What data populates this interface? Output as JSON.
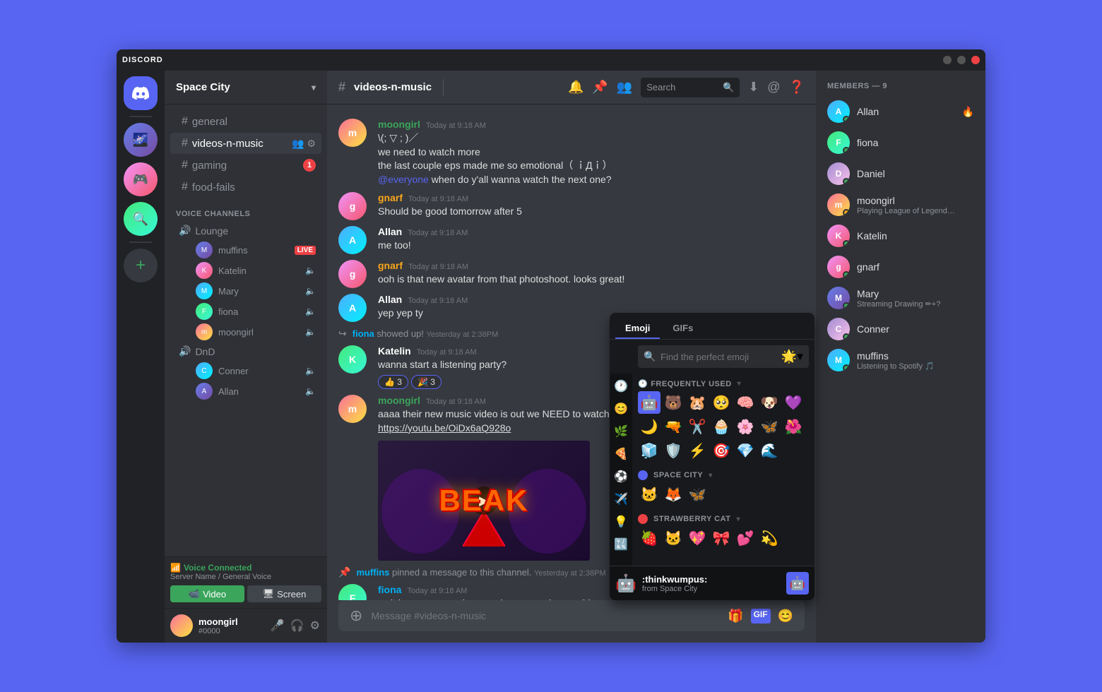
{
  "window": {
    "title": "DISCORD",
    "minimize": "—",
    "maximize": "□",
    "close": "✕"
  },
  "server": {
    "name": "Space City",
    "chevron": "▾"
  },
  "channels": {
    "text": [
      {
        "name": "general",
        "type": "text"
      },
      {
        "name": "videos-n-music",
        "type": "text",
        "active": true,
        "has_settings": true
      },
      {
        "name": "gaming",
        "type": "text",
        "badge": "1"
      },
      {
        "name": "food-fails",
        "type": "text"
      }
    ],
    "voice_header": "VOICE CHANNELS",
    "voice": [
      {
        "name": "Lounge",
        "users": [
          {
            "name": "muffins",
            "live": true,
            "class": "muffins"
          },
          {
            "name": "Katelin",
            "class": "katelin"
          },
          {
            "name": "Mary",
            "class": "mary"
          },
          {
            "name": "fiona",
            "class": "fiona"
          },
          {
            "name": "moongirl",
            "class": "moongirl"
          }
        ]
      },
      {
        "name": "DnD",
        "users": [
          {
            "name": "Conner",
            "class": "mary"
          },
          {
            "name": "Allan",
            "class": "msg-av-1"
          }
        ]
      }
    ]
  },
  "current_channel": "videos-n-music",
  "header": {
    "channel_icon": "#",
    "channel_name": "videos-n-music",
    "search_placeholder": "Search",
    "actions": [
      "bell",
      "pin",
      "members",
      "search",
      "download",
      "mention",
      "help"
    ]
  },
  "messages": [
    {
      "id": "m1",
      "avatar_class": "msg-av-5",
      "username": "moongirl",
      "username_color": "green",
      "time": "Today at 9:18 AM",
      "text": "\\(; ▽ ; )／",
      "text2": "we need to watch more",
      "text3": "the last couple eps made me so emotional（ ｉДｉ）",
      "text4": "@everyone when do y'all wanna watch the next one?"
    },
    {
      "id": "m2",
      "avatar_class": "msg-av-2",
      "username": "gnarf",
      "username_color": "orange",
      "time": "Today at 9:18 AM",
      "text": "Should be good tomorrow after 5"
    },
    {
      "id": "m3",
      "avatar_class": "msg-av-3",
      "username": "Allan",
      "username_color": "white",
      "time": "Today at 9:18 AM",
      "text": "me too!"
    },
    {
      "id": "m4",
      "avatar_class": "msg-av-2",
      "username": "gnarf",
      "username_color": "orange",
      "time": "Today at 9:18 AM",
      "text": "ooh is that new avatar from that photoshoot. looks great!"
    },
    {
      "id": "m5",
      "avatar_class": "msg-av-3",
      "username": "Allan",
      "username_color": "white",
      "time": "Today at 9:18 AM",
      "text": "yep yep ty"
    },
    {
      "id": "m6",
      "system": true,
      "username": "fiona",
      "time": "Yesterday at 2:38PM",
      "text": "showed up!"
    },
    {
      "id": "m7",
      "avatar_class": "msg-av-4",
      "username": "Katelin",
      "username_color": "white",
      "time": "Today at 9:18 AM",
      "text": "wanna start a listening party?",
      "reactions": [
        {
          "emoji": "👍",
          "count": "3"
        },
        {
          "emoji": "🎉",
          "count": "3"
        }
      ]
    },
    {
      "id": "m8",
      "avatar_class": "msg-av-5",
      "username": "moongirl",
      "username_color": "green",
      "time": "Today at 9:18 AM",
      "text": "aaaa their new music video is out we NEED to watch togethe...",
      "link": "https://youtu.be/OiDx6aQ928o",
      "has_video": true
    }
  ],
  "system_message": {
    "username": "fiona",
    "action": "showed up!",
    "time": "Yesterday at 2:38PM"
  },
  "fiona_bottom": {
    "avatar_class": "msg-av-4",
    "username": "fiona",
    "time": "Today at 9:18 AM",
    "text": "wait have you see the new dance practice one??"
  },
  "muffins_pinned": {
    "username": "muffins",
    "time": "Yesterday at 2:38PM",
    "text": "pinned a message to this channel."
  },
  "message_input": {
    "placeholder": "Message #videos-n-music"
  },
  "members": {
    "header": "MEMBERS — 9",
    "list": [
      {
        "name": "Allan",
        "badge": "🔥",
        "status": "online",
        "av_class": "msg-av-3"
      },
      {
        "name": "fiona",
        "status": "online",
        "av_class": "msg-av-4"
      },
      {
        "name": "Daniel",
        "status": "online",
        "av_class": "msg-av-6"
      },
      {
        "name": "moongirl",
        "status": "idle",
        "activity": "Playing League of Legends",
        "av_class": "msg-av-5"
      },
      {
        "name": "Katelin",
        "status": "online",
        "av_class": "msg-av-2"
      },
      {
        "name": "gnarf",
        "status": "online",
        "av_class": "msg-av-2"
      },
      {
        "name": "Mary",
        "status": "online",
        "activity": "Streaming Drawing ✏+?",
        "av_class": "msg-av-1"
      },
      {
        "name": "Conner",
        "status": "online",
        "av_class": "msg-av-6"
      },
      {
        "name": "muffins",
        "activity": "Listening to Spotify 🎵",
        "status": "online",
        "av_class": "msg-av-3"
      }
    ]
  },
  "emoji_picker": {
    "tabs": [
      "Emoji",
      "GIFs"
    ],
    "active_tab": "Emoji",
    "search_placeholder": "Find the perfect emoji",
    "skin_tone": "🌟",
    "categories": {
      "frequently_used": "FREQUENTLY USED",
      "space_city": "SPACE CITY",
      "strawberry_cat": "STRAWBERRY CAT"
    },
    "frequently_emojis": [
      "🤖",
      "🐻",
      "🐹",
      "🥺",
      "🧠",
      "🐶",
      "💜",
      "🌙",
      "🔫",
      "✂️",
      "🧁",
      "🌸",
      "🦋",
      "🌸",
      "🧊",
      "🛡️",
      "⚡",
      "🎯",
      "💎",
      "🌊"
    ],
    "space_city_emojis": [
      "🐱",
      "🦊",
      "🦋"
    ],
    "strawberry_cat_emojis": [
      "🍓",
      "🐱",
      "💖",
      "🎀",
      "💕",
      "💫"
    ],
    "tooltip": {
      "emoji": "🤖",
      "name": ":thinkwumpus:",
      "from": "from Space City"
    }
  },
  "voice_connected": {
    "status": "Voice Connected",
    "server": "Server Name / General Voice",
    "video_label": "Video",
    "screen_label": "Screen"
  },
  "bottom_user": {
    "name": "moongirl",
    "tag": "#0000"
  }
}
